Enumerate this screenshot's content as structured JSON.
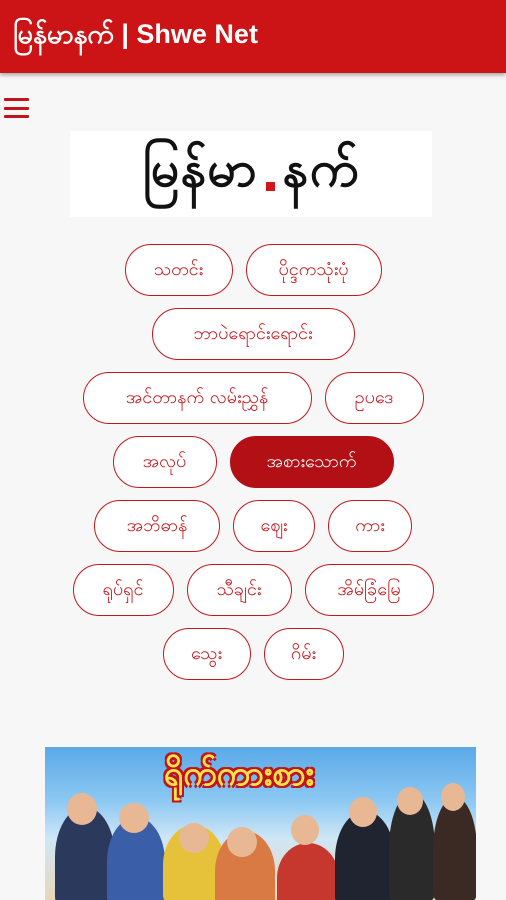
{
  "app_bar": {
    "title": "မြန်မာနက် | Shwe Net"
  },
  "logo": {
    "left": "မြန်မာ",
    "right": "နက်"
  },
  "categories": [
    [
      "သတင်း",
      "ပိုင္ဒကသုံးပုံ"
    ],
    [
      "ဘာပဲရောင်းရောင်း"
    ],
    [
      "အင်တာနက် လမ်းညွှန်",
      "ဥပဒေ"
    ],
    [
      "အလုပ်",
      "အစားသောက်"
    ],
    [
      "အဘိဓာန်",
      "ဈေး",
      "ကား"
    ],
    [
      "ရုပ်ရှင်",
      "သီချင်း",
      "အိမ်ခြံမြေ"
    ],
    [
      "သွေး",
      "ဂိမ်း"
    ]
  ],
  "active_category": "အစားသောက်",
  "banner": {
    "title": "ရိုက်ကားစား"
  },
  "colors": {
    "brand": "#cc1416",
    "accent": "#c4161c",
    "background": "#f7f7f7"
  }
}
